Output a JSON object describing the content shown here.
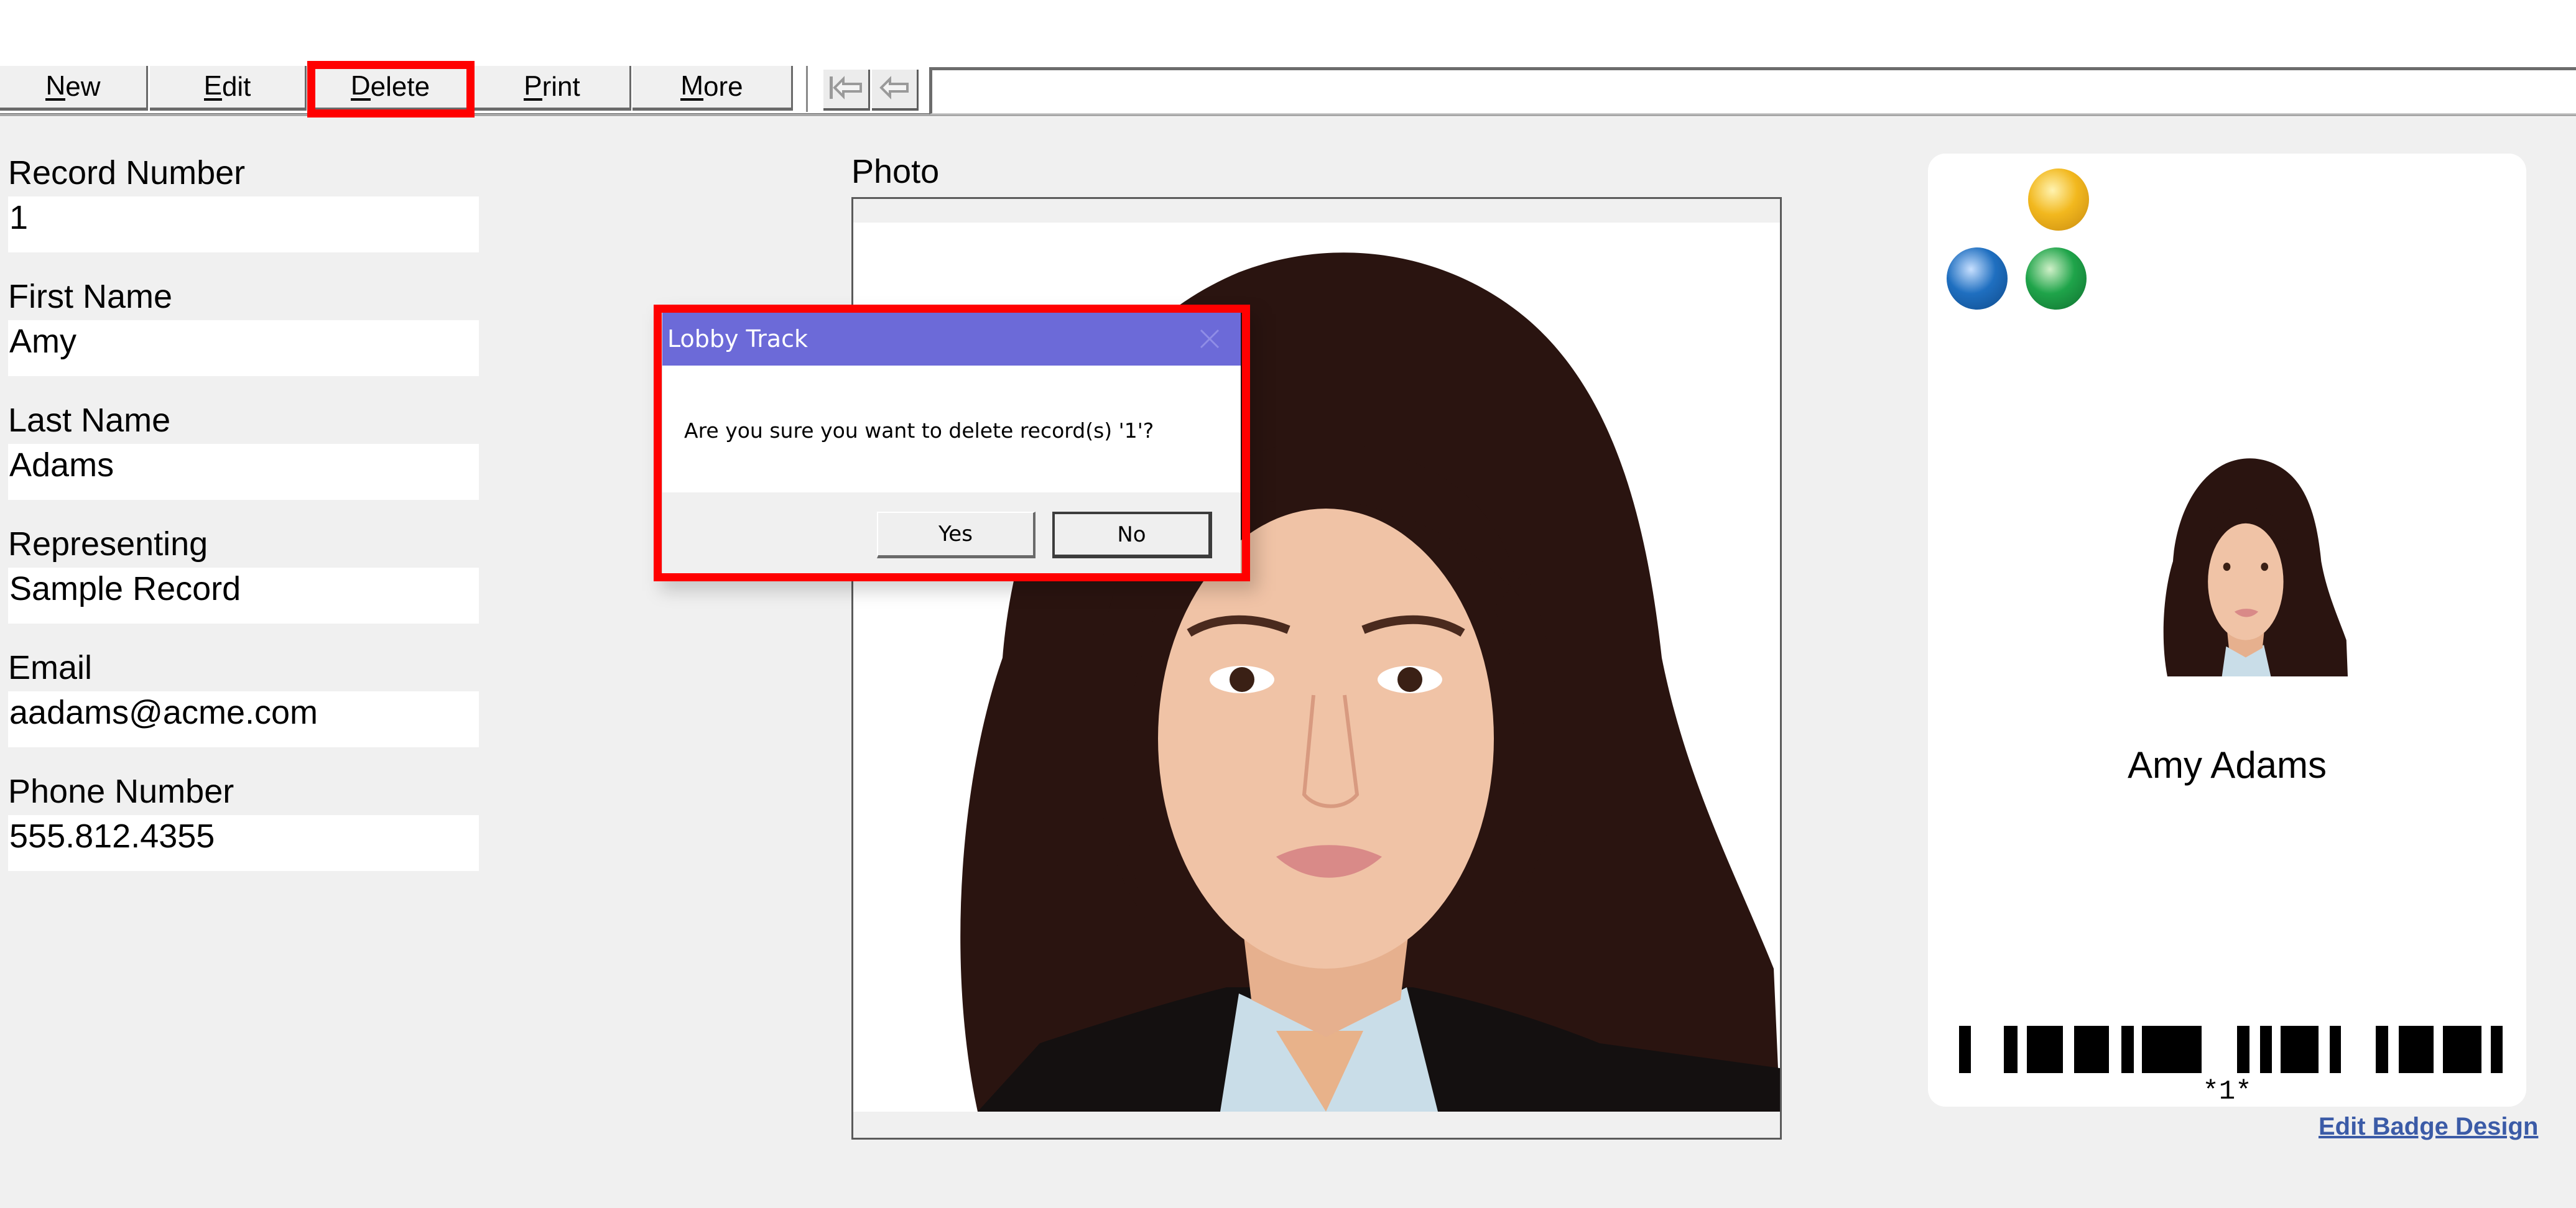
{
  "toolbar": {
    "buttons": [
      {
        "label_mnemonic": "N",
        "label_rest": "ew",
        "label": "New"
      },
      {
        "label_mnemonic": "E",
        "label_rest": "dit",
        "label": "Edit"
      },
      {
        "label_mnemonic": "D",
        "label_rest": "elete",
        "label": "Delete",
        "highlighted": true
      },
      {
        "label_mnemonic": "P",
        "label_rest": "rint",
        "label": "Print"
      },
      {
        "label_mnemonic": "M",
        "label_rest": "ore",
        "label": "More"
      }
    ],
    "nav": [
      {
        "icon": "first-record-icon",
        "glyph": "⇤"
      },
      {
        "icon": "previous-record-icon",
        "glyph": "⇦"
      }
    ],
    "search": {
      "value": "",
      "placeholder": ""
    }
  },
  "form": {
    "fields": [
      {
        "label": "Record Number",
        "value": "1"
      },
      {
        "label": "First Name",
        "value": "Amy"
      },
      {
        "label": "Last Name",
        "value": "Adams"
      },
      {
        "label": "Representing",
        "value": "Sample Record"
      },
      {
        "label": "Email",
        "value": "aadams@acme.com"
      },
      {
        "label": "Phone Number",
        "value": "555.812.4355"
      }
    ]
  },
  "photo": {
    "label": "Photo",
    "alt": "Portrait photo of visitor"
  },
  "badge": {
    "name": "Amy Adams",
    "barcode_text": "*1*",
    "logo_colors": {
      "yellow": "#f2b81e",
      "blue": "#1f6fc0",
      "green": "#1fa44a"
    },
    "edit_link": "Edit Badge Design"
  },
  "dialog": {
    "title": "Lobby Track",
    "message": "Are you sure you want to delete record(s) '1'?",
    "yes_label": "Yes",
    "no_label": "No",
    "close_glyph": "✕",
    "title_color": "#6c6ad8"
  },
  "annotation": {
    "highlight_color": "#ff0000"
  }
}
